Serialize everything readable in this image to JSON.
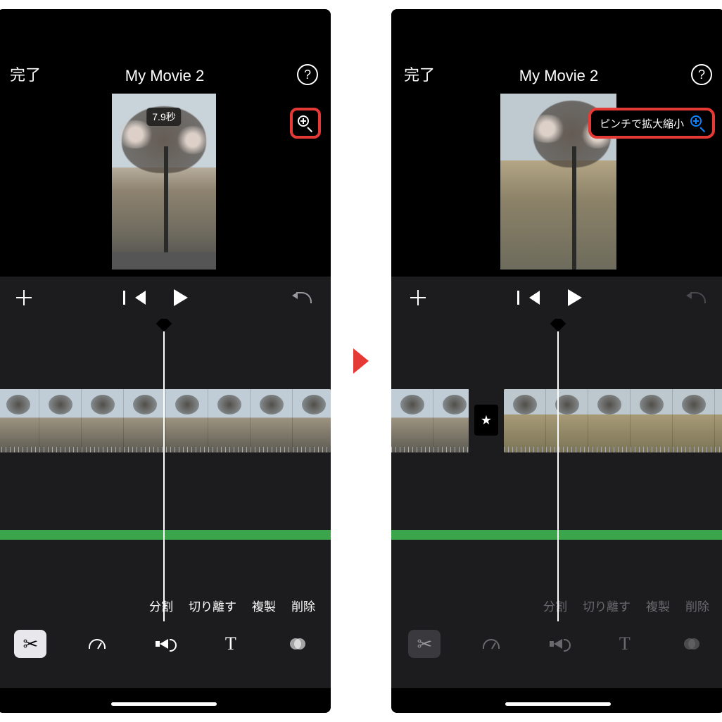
{
  "left": {
    "header": {
      "done_label": "完了",
      "title": "My Movie 2",
      "help_label": "?"
    },
    "preview": {
      "duration_badge": "7.9秒"
    },
    "actions": {
      "split": "分割",
      "detach": "切り離す",
      "duplicate": "複製",
      "delete": "削除"
    }
  },
  "right": {
    "header": {
      "done_label": "完了",
      "title": "My Movie 2",
      "help_label": "?"
    },
    "preview": {
      "pinch_hint": "ピンチで拡大縮小"
    },
    "actions": {
      "split": "分割",
      "detach": "切り離す",
      "duplicate": "複製",
      "delete": "削除"
    }
  },
  "toolbar_icons": {
    "scissors": "✂",
    "gauge": "speed",
    "volume": "vol",
    "text": "T",
    "filters": "filters"
  }
}
